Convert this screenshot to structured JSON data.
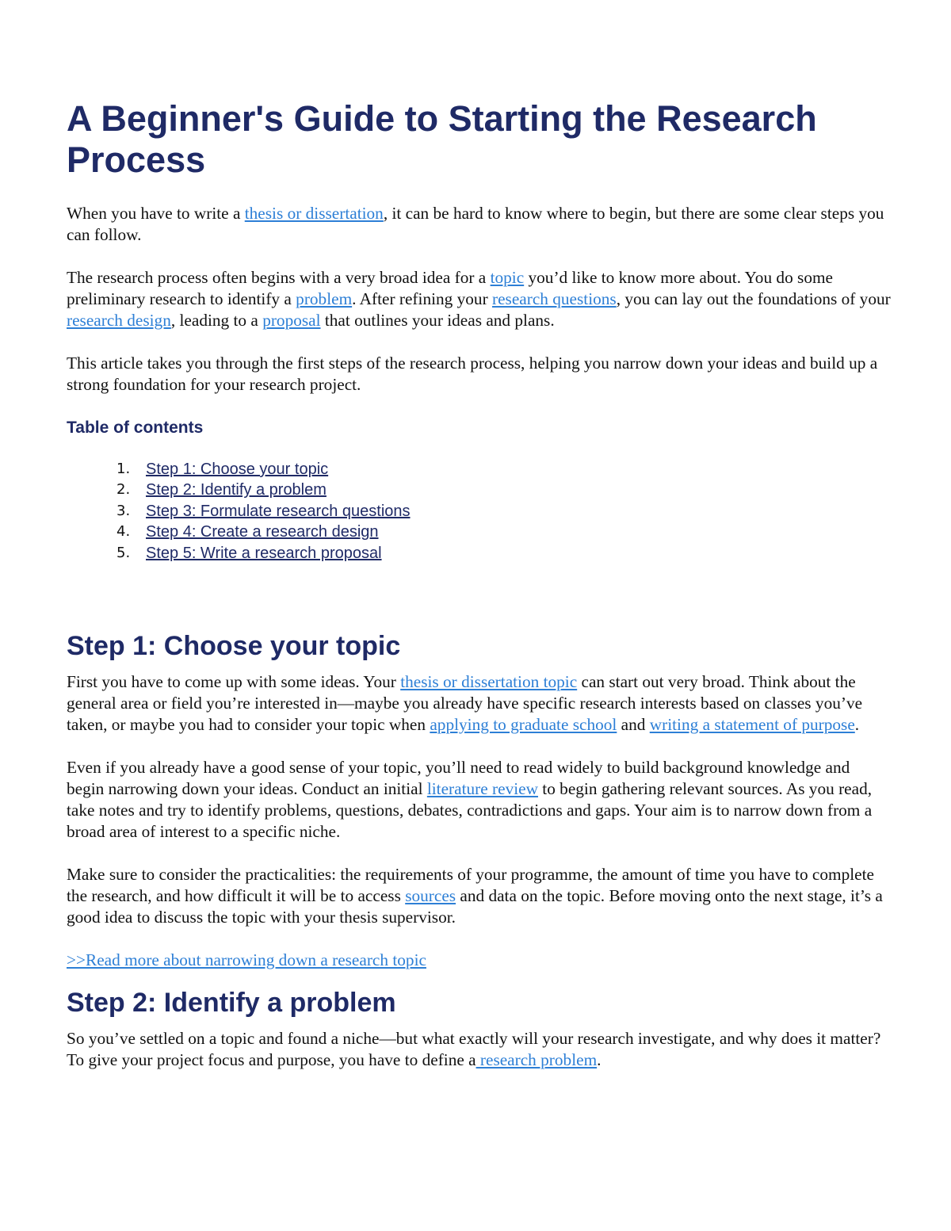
{
  "title": "A Beginner's Guide to Starting the Research Process",
  "intro": {
    "p1": {
      "t1": "When you have to write a ",
      "l1": "thesis or dissertation",
      "t2": ", it can be hard to know where to begin, but there are some clear steps you can follow."
    },
    "p2": {
      "t1": "The research process often begins with a very broad idea for a ",
      "l1": "topic",
      "t2": " you’d like to know more about. You do some preliminary research to identify a ",
      "l2": "problem",
      "t3": ". After refining your ",
      "l3": "research questions",
      "t4": ", you can lay out the foundations of your ",
      "l4": "research design",
      "t5": ", leading to a ",
      "l5": "proposal",
      "t6": " that outlines your ideas and plans."
    },
    "p3": "This article takes you through the first steps of the research process, helping you narrow down your ideas and build up a strong foundation for your research project."
  },
  "toc": {
    "heading": "Table of contents",
    "items": [
      {
        "num": "1.",
        "label": "Step 1: Choose your topic"
      },
      {
        "num": "2.",
        "label": "Step 2: Identify a problem"
      },
      {
        "num": "3.",
        "label": "Step 3: Formulate research questions"
      },
      {
        "num": "4.",
        "label": "Step 4: Create a research design"
      },
      {
        "num": "5.",
        "label": "Step 5: Write a research proposal"
      }
    ]
  },
  "step1": {
    "heading": "Step 1: Choose your topic",
    "p1": {
      "t1": "First you have to come up with some ideas. Your ",
      "l1": "thesis or dissertation topic",
      "t2": " can start out very broad. Think about the general area or field you’re interested in—maybe you already have specific research interests based on classes you’ve taken, or maybe you had to consider your topic when ",
      "l2": "applying to graduate school",
      "t3": " and ",
      "l3": "writing a statement of purpose",
      "t4": "."
    },
    "p2": {
      "t1": "Even if you already have a good sense of your topic, you’ll need to read widely to build background knowledge and begin narrowing down your ideas. Conduct an initial ",
      "l1": "literature review",
      "t2": " to begin gathering relevant sources. As you read, take notes and try to identify problems, questions, debates, contradictions and gaps. Your aim is to narrow down from a broad area of interest to a specific niche."
    },
    "p3": {
      "t1": "Make sure to consider the practicalities: the requirements of your programme, the amount of time you have to complete the research, and how difficult it will be to access ",
      "l1": "sources",
      "t2": " and data on the topic. Before moving onto the next stage, it’s a good idea to discuss the topic with your thesis supervisor."
    },
    "read_more": ">>Read more about narrowing down a research topic"
  },
  "step2": {
    "heading": "Step 2: Identify a problem",
    "p1": {
      "t1": "So you’ve settled on a topic and found a niche—but what exactly will your research investigate, and why does it matter? To give your project focus and purpose, you have to define a",
      "l1": " research problem",
      "t2": "."
    }
  }
}
